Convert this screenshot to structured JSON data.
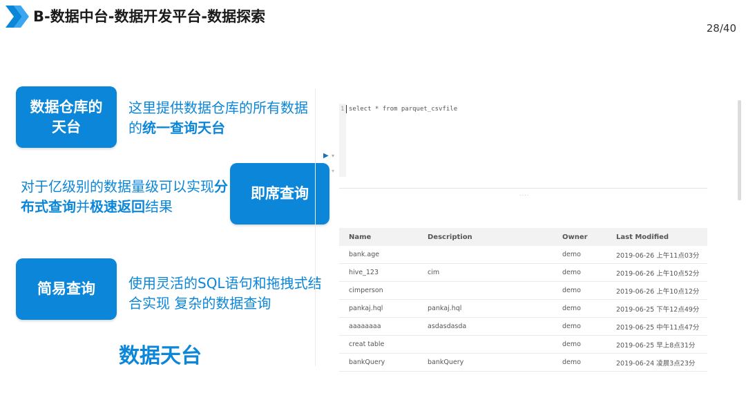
{
  "header": {
    "title": "B-数据中台-数据开发平台-数据探索",
    "page": "28/40"
  },
  "features": [
    {
      "badge_line1": "数据仓库的",
      "badge_line2": "天台",
      "desc_pre": "这里提供数据仓库的所有数据的",
      "desc_bold": "统一查询天台",
      "desc_post": ""
    },
    {
      "badge": "即席查询",
      "desc_pre": "对于亿级别的数据量级可以实现",
      "desc_bold1": "分布式查询",
      "desc_mid": "并",
      "desc_bold2": "极速返回",
      "desc_post": "结果"
    },
    {
      "badge": "简易查询",
      "desc": "使用灵活的SQL语句和拖拽式结合实现 复杂的数据查询"
    }
  ],
  "footer_title": "数据天台",
  "editor": {
    "line_number": "1",
    "code": "select * from parquet_csvfile",
    "resize_handle": "....",
    "run_icon": "play-icon"
  },
  "table": {
    "columns": [
      "Name",
      "Description",
      "Owner",
      "Last Modified"
    ],
    "rows": [
      [
        "bank.age",
        "",
        "demo",
        "2019-06-26 上午11点03分"
      ],
      [
        "hive_123",
        "cim",
        "demo",
        "2019-06-26 上午10点52分"
      ],
      [
        "cimperson",
        "",
        "demo",
        "2019-06-26 上午10点12分"
      ],
      [
        "pankaj.hql",
        "pankaj.hql",
        "demo",
        "2019-06-25 下午12点49分"
      ],
      [
        "aaaaaaaa",
        "asdasdasda",
        "demo",
        "2019-06-25 中午11点47分"
      ],
      [
        "creat table",
        "",
        "demo",
        "2019-06-25 早上8点31分"
      ],
      [
        "bankQuery",
        "bankQuery",
        "demo",
        "2019-06-24 凌晨3点23分"
      ]
    ]
  },
  "colors": {
    "accent": "#0b86d9",
    "title": "#1a1a1a"
  }
}
